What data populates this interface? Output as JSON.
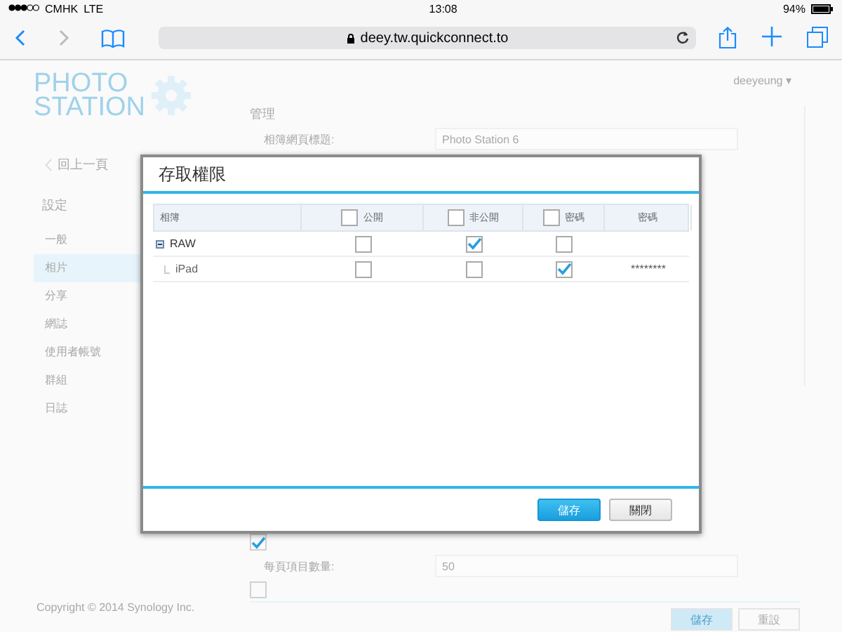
{
  "status_bar": {
    "carrier": "CMHK",
    "network": "LTE",
    "time": "13:08",
    "battery": "94%"
  },
  "browser": {
    "url": "deey.tw.quickconnect.to"
  },
  "page": {
    "logo_line1": "PHOTO",
    "logo_line2": "STATION",
    "user": "deeyeung",
    "user_caret": "▾",
    "back": "回上一頁",
    "section": "設定",
    "nav": [
      {
        "label": "一般",
        "selected": false
      },
      {
        "label": "相片",
        "selected": true
      },
      {
        "label": "分享",
        "selected": false
      },
      {
        "label": "網誌",
        "selected": false
      },
      {
        "label": "使用者帳號",
        "selected": false
      },
      {
        "label": "群組",
        "selected": false
      },
      {
        "label": "日誌",
        "selected": false
      }
    ],
    "heading": "管理",
    "title_label": "相簿網頁標題:",
    "title_value": "Photo Station 6",
    "option_checked": true,
    "items_label": "每頁項目數量:",
    "items_value": "50",
    "option2_checked": false,
    "copyright": "Copyright © 2014 Synology Inc.",
    "buttons": [
      "儲存",
      "重設"
    ]
  },
  "dialog": {
    "title": "存取權限",
    "columns": [
      {
        "label": "相簿",
        "kind": "text"
      },
      {
        "label": "公開",
        "kind": "checkbox",
        "checked": false
      },
      {
        "label": "非公開",
        "kind": "checkbox",
        "checked": false
      },
      {
        "label": "密碼",
        "kind": "checkbox",
        "checked": false
      },
      {
        "label": "密碼",
        "kind": "text"
      }
    ],
    "rows": [
      {
        "name": "RAW",
        "public": false,
        "private": true,
        "protected": false,
        "children": [
          {
            "name": "iPad",
            "public": false,
            "private": false,
            "protected": true,
            "password": "********"
          }
        ]
      }
    ],
    "buttons": [
      {
        "label": "儲存",
        "kind": "primary"
      },
      {
        "label": "關閉",
        "kind": "secondary"
      }
    ]
  }
}
